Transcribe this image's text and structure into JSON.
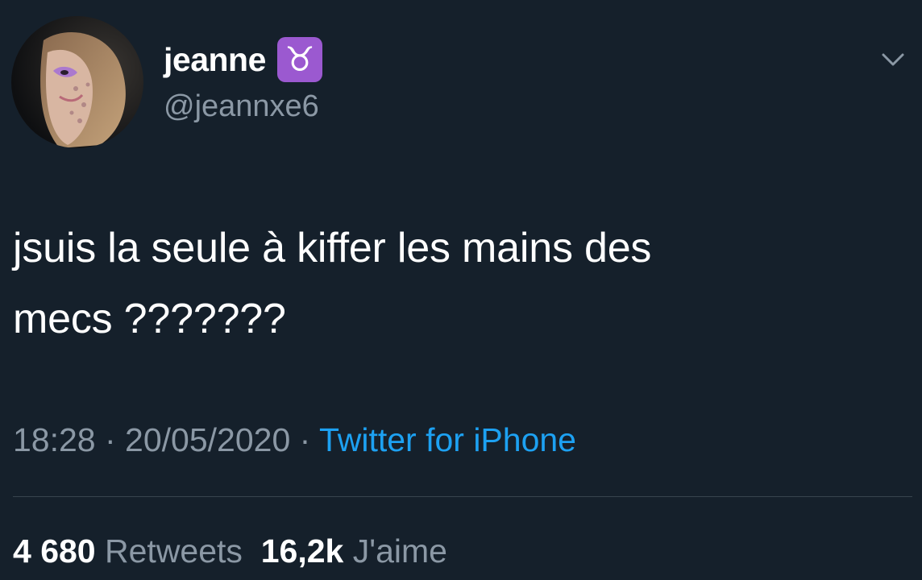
{
  "user": {
    "display_name": "jeanne",
    "badge_glyph": "♉",
    "badge_icon": "taurus-zodiac-icon",
    "handle": "@jeannxe6",
    "avatar_icon": "profile-avatar"
  },
  "tweet": {
    "line1": "jsuis la seule à kiffer les mains des",
    "line2": "mecs ???????"
  },
  "meta": {
    "time": "18:28",
    "sep1": " · ",
    "date": "20/05/2020",
    "sep2": " · ",
    "source": "Twitter for iPhone"
  },
  "stats": {
    "retweets_count": "4 680",
    "retweets_label": "Retweets",
    "likes_count": "16,2k",
    "likes_label": "J'aime"
  },
  "colors": {
    "background": "#15202b",
    "secondary_text": "#8b98a5",
    "link": "#1da1f2",
    "badge": "#9b59d0"
  }
}
